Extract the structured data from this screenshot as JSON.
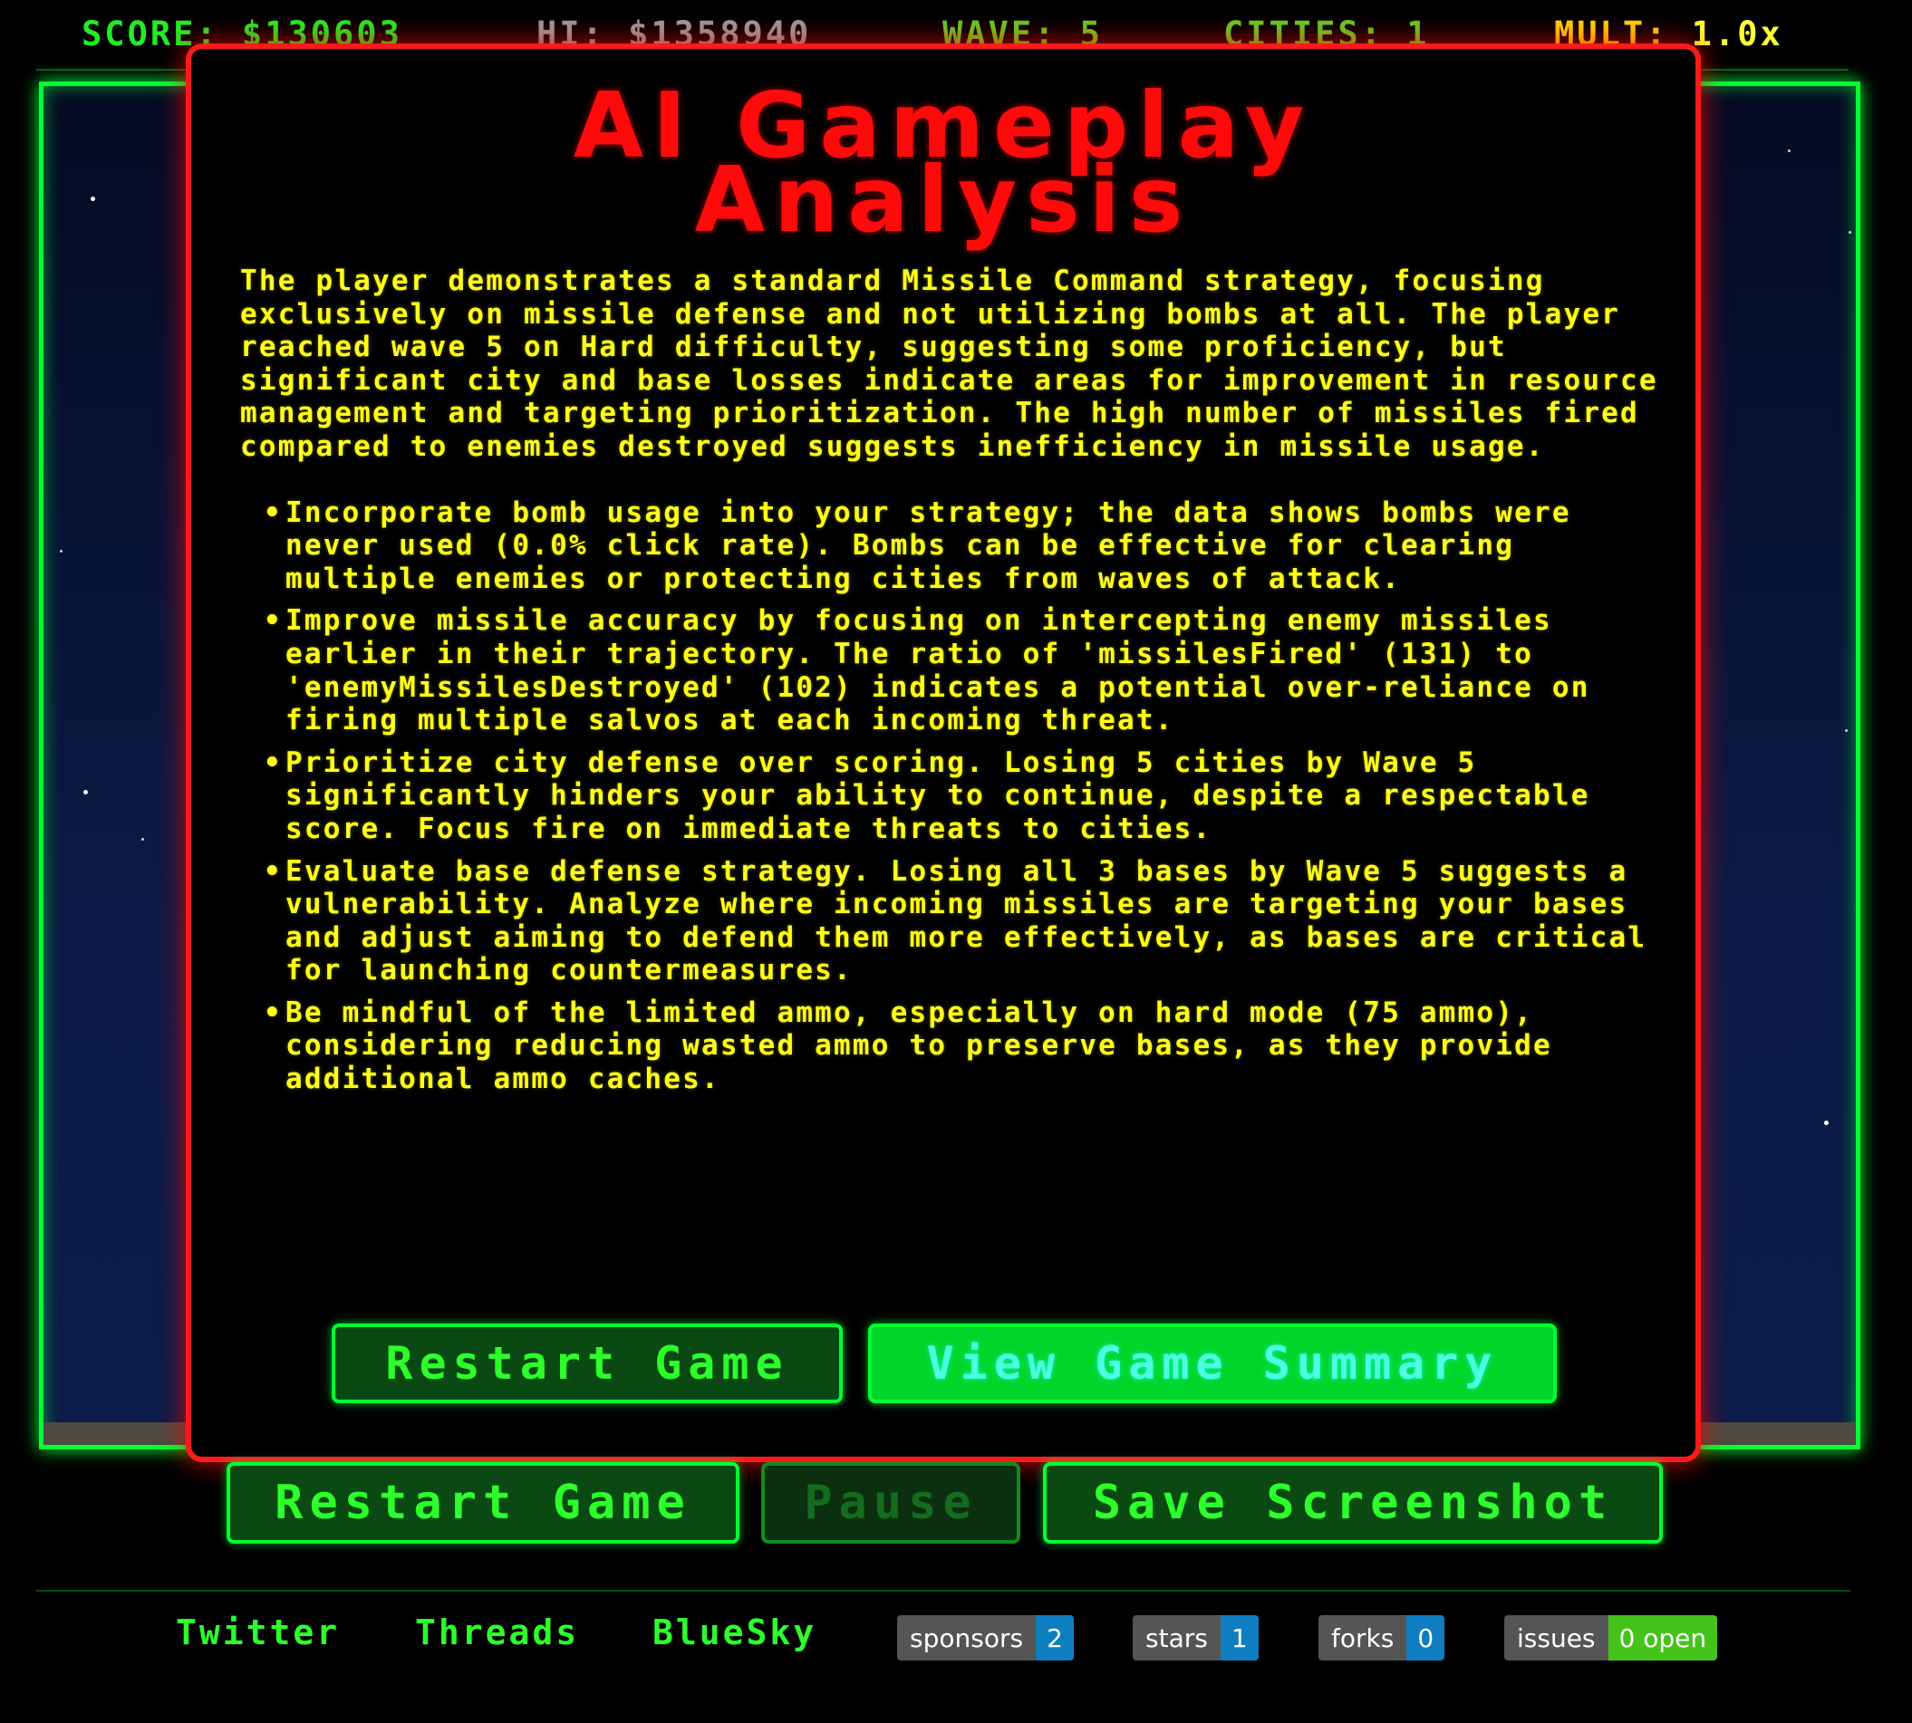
{
  "hud": {
    "score": "SCORE: $130603",
    "hi": "HI: $1358940",
    "wave": "WAVE: 5",
    "cities": "CITIES: 1",
    "mult_label": "MULT:",
    "mult_value": "1.0x"
  },
  "modal": {
    "title_line1": "AI Gameplay",
    "title_line2": "Analysis",
    "summary": "The player demonstrates a standard Missile Command strategy, focusing exclusively on missile defense and not utilizing bombs at all. The player reached wave 5 on Hard difficulty, suggesting some proficiency, but significant city and base losses indicate areas for improvement in resource management and targeting prioritization. The high number of missiles fired compared to enemies destroyed suggests inefficiency in missile usage.",
    "tips": [
      "Incorporate bomb usage into your strategy; the data shows bombs were never used (0.0% click rate). Bombs can be effective for clearing multiple enemies or protecting cities from waves of attack.",
      "Improve missile accuracy by focusing on intercepting enemy missiles earlier in their trajectory. The ratio of 'missilesFired' (131) to 'enemyMissilesDestroyed' (102) indicates a potential over-reliance on firing multiple salvos at each incoming threat.",
      "Prioritize city defense over scoring. Losing 5 cities by Wave 5 significantly hinders your ability to continue, despite a respectable score. Focus fire on immediate threats to cities.",
      "Evaluate base defense strategy. Losing all 3 bases by Wave 5 suggests a vulnerability. Analyze where incoming missiles are targeting your bases and adjust aiming to defend them more effectively, as bases are critical for launching countermeasures.",
      "Be mindful of the limited ammo, especially on hard mode (75 ammo), considering reducing wasted ammo to preserve bases, as they provide additional ammo caches."
    ],
    "restart_label": "Restart Game",
    "summary_label": "View Game Summary"
  },
  "controls": {
    "restart_label": "Restart Game",
    "pause_label": "Pause",
    "save_label": "Save Screenshot"
  },
  "footer": {
    "twitter": "Twitter",
    "threads": "Threads",
    "bluesky": "BlueSky",
    "badges": {
      "sponsors": {
        "label": "sponsors",
        "value": "2"
      },
      "stars": {
        "label": "stars",
        "value": "1"
      },
      "forks": {
        "label": "forks",
        "value": "0"
      },
      "issues": {
        "label": "issues",
        "value": "0 open"
      }
    }
  },
  "colors": {
    "accent_green": "#00ff33",
    "modal_border": "#ff1a1a",
    "text_yellow": "#ffff1a"
  }
}
